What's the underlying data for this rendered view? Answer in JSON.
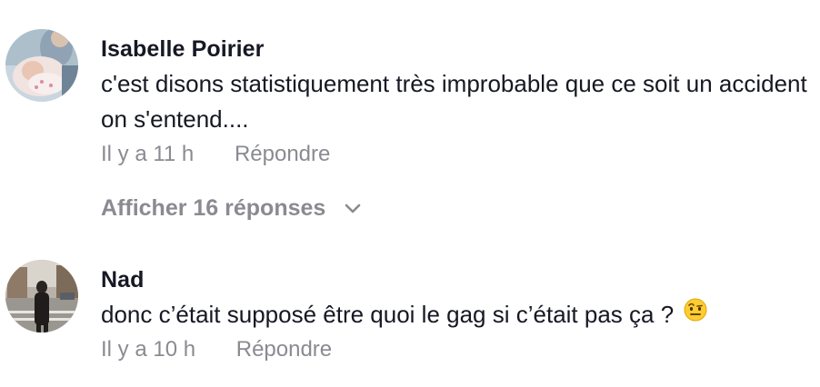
{
  "comments": [
    {
      "author": "Isabelle Poirier",
      "text": "c'est disons statistiquement très improbable que ce soit un accident on s'entend....",
      "time": "Il y a 11 h",
      "reply_label": "Répondre",
      "replies_label": "Afficher 16 réponses",
      "avatar_icon": "baby-photo-avatar"
    },
    {
      "author": "Nad",
      "text": "donc c’était supposé être quoi le gag si c’était pas ça ?",
      "emoji": "raised-eyebrow-emoji",
      "time": "Il y a 10 h",
      "reply_label": "Répondre",
      "avatar_icon": "city-street-photo-avatar"
    }
  ],
  "colors": {
    "text_primary": "#161823",
    "text_secondary": "#8a8b91"
  }
}
